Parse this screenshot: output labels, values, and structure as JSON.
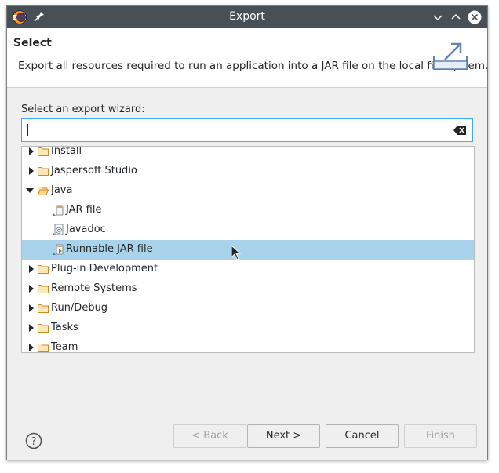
{
  "window": {
    "title": "Export"
  },
  "header": {
    "title": "Select",
    "description": "Export all resources required to run an application into a JAR file on the local file system."
  },
  "filter": {
    "label": "Select an export wizard:",
    "value": ""
  },
  "tree": {
    "items": [
      {
        "label": "Install",
        "type": "folder",
        "expanded": false,
        "depth": 0
      },
      {
        "label": "Jaspersoft Studio",
        "type": "folder",
        "expanded": false,
        "depth": 0
      },
      {
        "label": "Java",
        "type": "folder",
        "expanded": true,
        "depth": 0
      },
      {
        "label": "JAR file",
        "type": "leaf",
        "icon": "jar-file-icon",
        "depth": 1
      },
      {
        "label": "Javadoc",
        "type": "leaf",
        "icon": "javadoc-icon",
        "depth": 1
      },
      {
        "label": "Runnable JAR file",
        "type": "leaf",
        "icon": "runnable-jar-icon",
        "depth": 1,
        "selected": true
      },
      {
        "label": "Plug-in Development",
        "type": "folder",
        "expanded": false,
        "depth": 0
      },
      {
        "label": "Remote Systems",
        "type": "folder",
        "expanded": false,
        "depth": 0
      },
      {
        "label": "Run/Debug",
        "type": "folder",
        "expanded": false,
        "depth": 0
      },
      {
        "label": "Tasks",
        "type": "folder",
        "expanded": false,
        "depth": 0
      },
      {
        "label": "Team",
        "type": "folder",
        "expanded": false,
        "depth": 0
      }
    ]
  },
  "buttons": {
    "back": "< Back",
    "next": "Next >",
    "cancel": "Cancel",
    "finish": "Finish"
  },
  "colors": {
    "titlebar": "#475057",
    "selection": "#a8d3ea",
    "focus": "#3daee9",
    "folder": "#f0a04b"
  }
}
